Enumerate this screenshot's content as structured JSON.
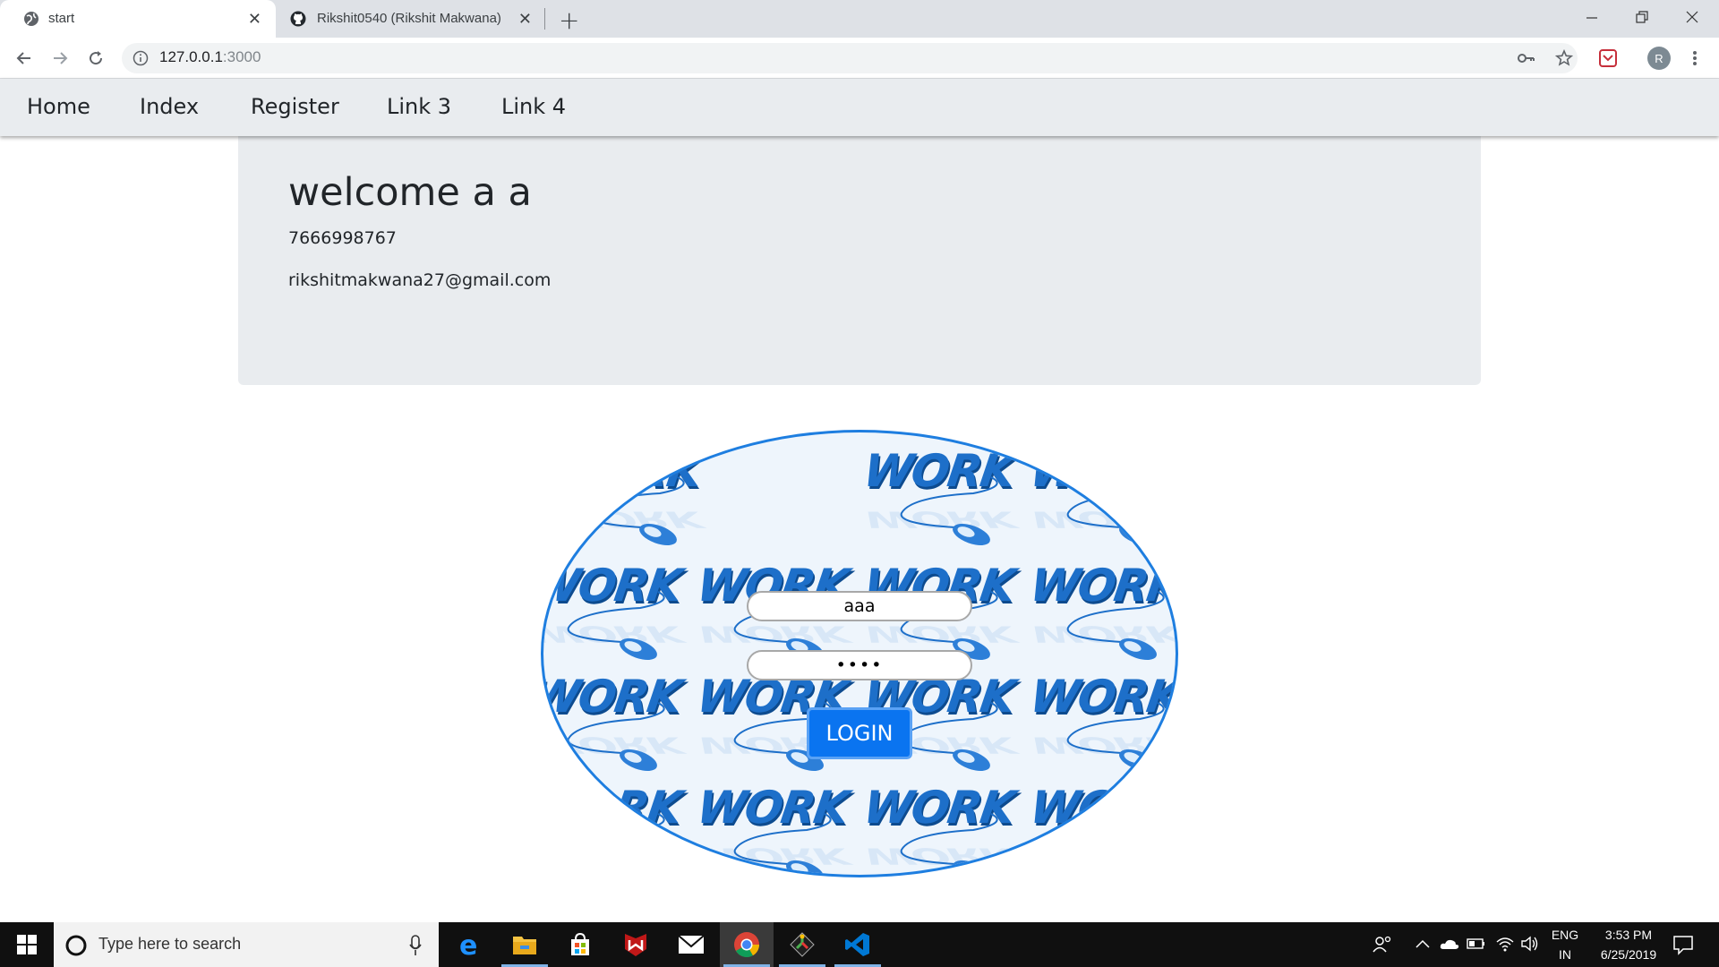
{
  "browser": {
    "tabs": [
      {
        "title": "start",
        "active": true
      },
      {
        "title": "Rikshit0540 (Rikshit Makwana)",
        "active": false
      }
    ],
    "url_host": "127.0.0.1",
    "url_port": ":3000",
    "profile_initial": "R"
  },
  "nav": {
    "links": [
      "Home",
      "Index",
      "Register",
      "Link 3",
      "Link 4"
    ]
  },
  "profile": {
    "welcome": "welcome a a",
    "phone": "7666998767",
    "email": "rikshitmakwana27@gmail.com"
  },
  "login": {
    "username_value": "aaa",
    "password_value": "••••",
    "button_label": "LOGIN",
    "background_word": "WORK"
  },
  "taskbar": {
    "search_placeholder": "Type here to search",
    "lang_top": "ENG",
    "lang_bottom": "IN",
    "time": "3:53 PM",
    "date": "6/25/2019"
  },
  "colors": {
    "accent": "#0a74f0",
    "oval_border": "#1e7ee0",
    "jumbotron": "#e9ecef"
  }
}
